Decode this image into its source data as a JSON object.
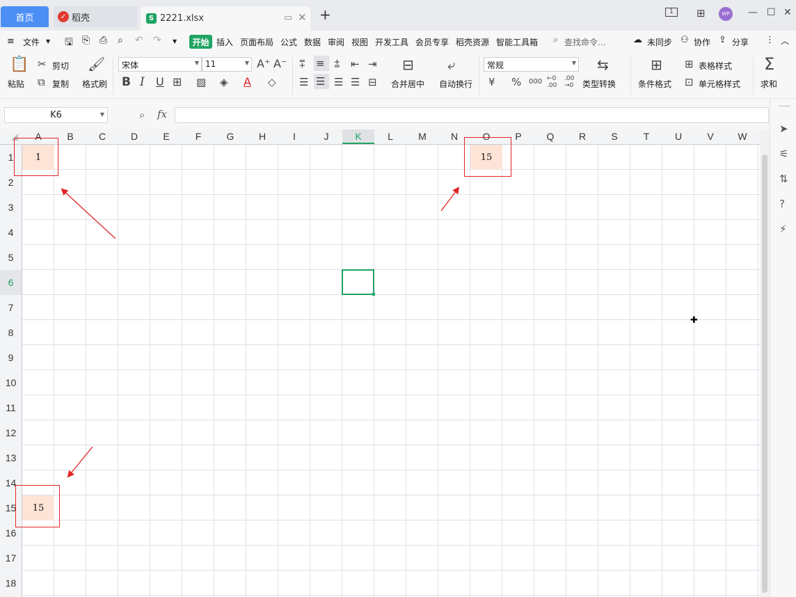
{
  "tabs": {
    "home": "首页",
    "daoke": "稻壳",
    "file": "2221.xlsx",
    "new_tab": "+",
    "avatar": "WP"
  },
  "menu": {
    "file": "文件",
    "start": "开始",
    "items": [
      "插入",
      "页面布局",
      "公式",
      "数据",
      "审阅",
      "视图",
      "开发工具",
      "会员专享",
      "稻壳资源",
      "智能工具箱"
    ],
    "search": "查找命令...",
    "sync": "未同步",
    "collab": "协作",
    "share": "分享"
  },
  "ribbon": {
    "paste": "粘贴",
    "cut": "剪切",
    "copy": "复制",
    "format_painter": "格式刷",
    "font_name": "宋体",
    "font_size": "11",
    "merge_center": "合并居中",
    "wrap": "自动换行",
    "number_format": "常规",
    "convert": "类型转换",
    "cond_format": "条件格式",
    "table_style": "表格样式",
    "cell_style": "单元格样式",
    "sum": "求和"
  },
  "formula_bar": {
    "name_box": "K6",
    "fx": "fx",
    "value": ""
  },
  "grid": {
    "columns": [
      "A",
      "B",
      "C",
      "D",
      "E",
      "F",
      "G",
      "H",
      "I",
      "J",
      "K",
      "L",
      "M",
      "N",
      "O",
      "P",
      "Q",
      "R",
      "S",
      "T",
      "U",
      "V",
      "W"
    ],
    "rows": [
      "1",
      "2",
      "3",
      "4",
      "5",
      "6",
      "7",
      "8",
      "9",
      "10",
      "11",
      "12",
      "13",
      "14",
      "15",
      "16",
      "17",
      "18"
    ],
    "selected_column": "K",
    "selected_row": "6",
    "cells": {
      "A1": "1",
      "O1": "15",
      "A15": "15"
    },
    "highlight_color": "#fde4d6",
    "annotation_color": "#e02424",
    "selection_color": "#21a366"
  }
}
